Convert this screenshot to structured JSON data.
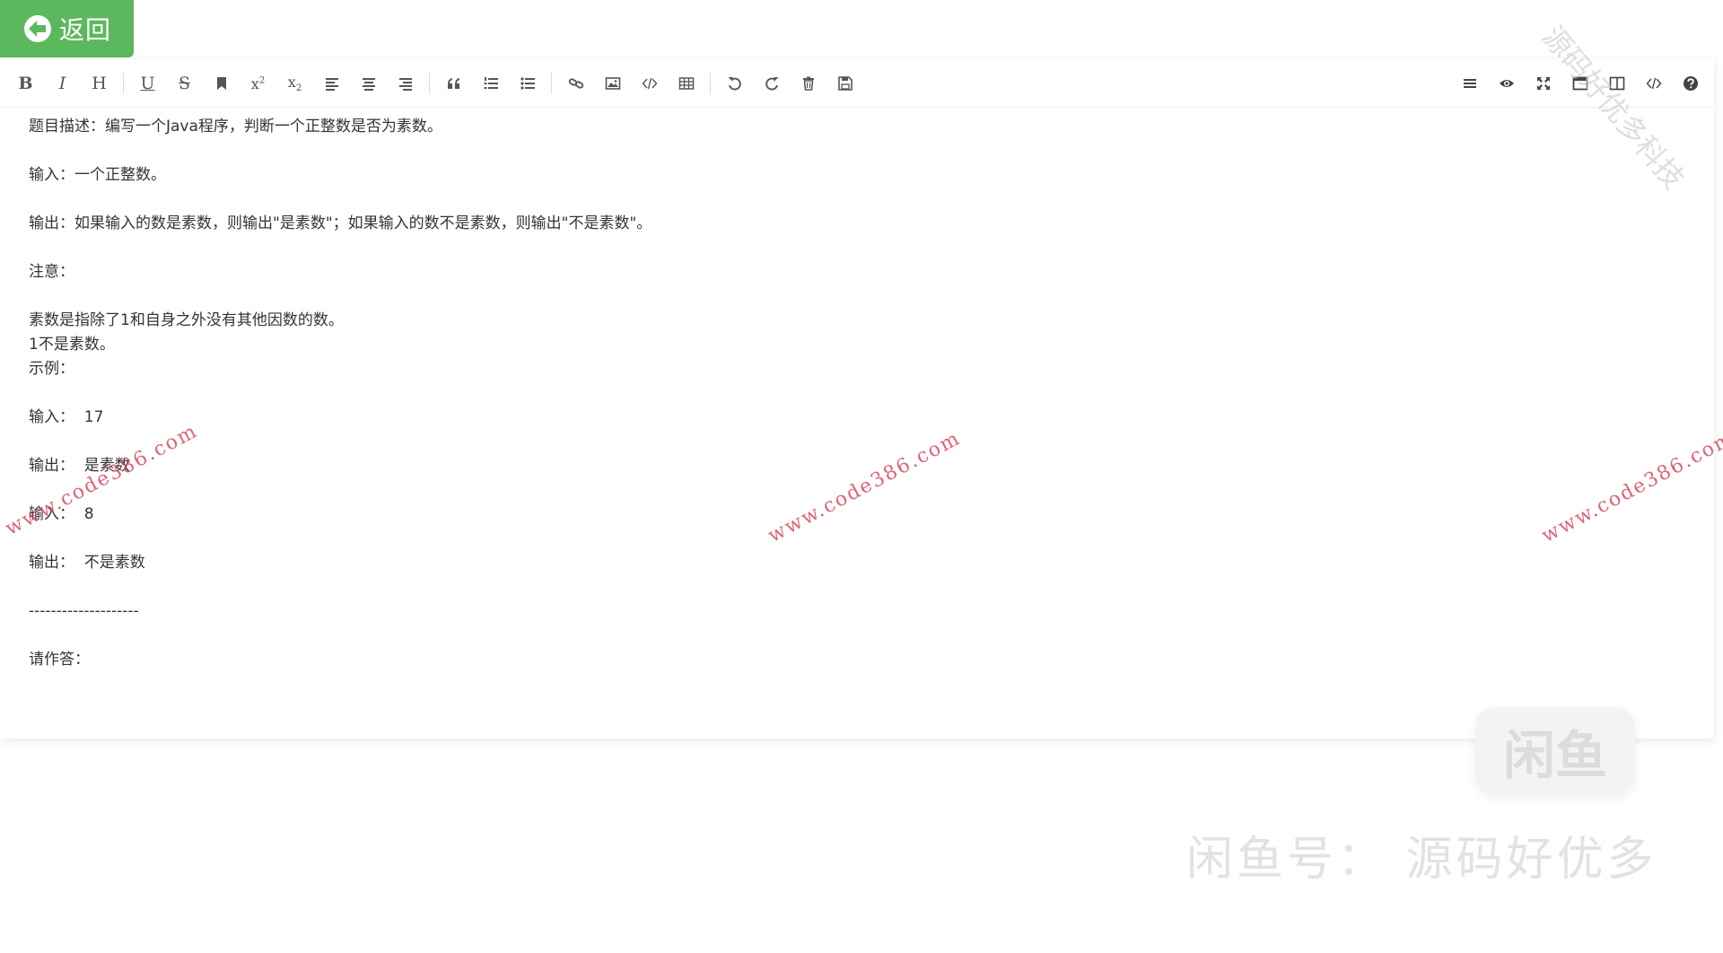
{
  "back_button": {
    "label": "返回",
    "icon": "arrow-left-circle-icon"
  },
  "toolbar": {
    "left": [
      {
        "name": "bold-button",
        "icon": "bold-icon",
        "glyph": "B"
      },
      {
        "name": "italic-button",
        "icon": "italic-icon",
        "glyph": "I"
      },
      {
        "name": "heading-button",
        "icon": "heading-icon",
        "glyph": "H"
      },
      {
        "name": "underline-button",
        "icon": "underline-icon",
        "glyph": "U"
      },
      {
        "name": "strikethrough-button",
        "icon": "strikethrough-icon",
        "glyph": "S"
      },
      {
        "name": "mark-button",
        "icon": "bookmark-icon"
      },
      {
        "name": "superscript-button",
        "icon": "superscript-icon",
        "glyph": "x",
        "small": "2"
      },
      {
        "name": "subscript-button",
        "icon": "subscript-icon",
        "glyph": "x",
        "small": "2"
      },
      {
        "name": "align-left-button",
        "icon": "align-left-icon"
      },
      {
        "name": "align-center-button",
        "icon": "align-center-icon"
      },
      {
        "name": "align-right-button",
        "icon": "align-right-icon"
      },
      {
        "name": "quote-button",
        "icon": "quote-icon"
      },
      {
        "name": "ordered-list-button",
        "icon": "ordered-list-icon"
      },
      {
        "name": "unordered-list-button",
        "icon": "unordered-list-icon"
      },
      {
        "name": "link-button",
        "icon": "link-icon"
      },
      {
        "name": "image-button",
        "icon": "image-icon"
      },
      {
        "name": "code-button",
        "icon": "code-icon"
      },
      {
        "name": "table-button",
        "icon": "table-icon"
      },
      {
        "name": "undo-button",
        "icon": "undo-icon"
      },
      {
        "name": "redo-button",
        "icon": "redo-icon"
      },
      {
        "name": "trash-button",
        "icon": "trash-icon"
      },
      {
        "name": "save-button",
        "icon": "save-icon"
      }
    ],
    "right": [
      {
        "name": "navigation-button",
        "icon": "menu-icon"
      },
      {
        "name": "preview-button",
        "icon": "eye-icon"
      },
      {
        "name": "fullscreen-button",
        "icon": "expand-icon"
      },
      {
        "name": "read-mode-button",
        "icon": "window-icon"
      },
      {
        "name": "split-view-button",
        "icon": "columns-icon"
      },
      {
        "name": "html-code-button",
        "icon": "code-icon"
      },
      {
        "name": "help-button",
        "icon": "question-circle-icon"
      }
    ]
  },
  "content": {
    "lines": [
      "题目描述：编写一个Java程序，判断一个正整数是否为素数。",
      "",
      "输入：一个正整数。",
      "",
      "输出：如果输入的数是素数，则输出\"是素数\"；如果输入的数不是素数，则输出\"不是素数\"。",
      "",
      "注意：",
      "",
      "素数是指除了1和自身之外没有其他因数的数。",
      "1不是素数。",
      "示例：",
      "",
      "输入：  17",
      "",
      "输出：  是素数",
      "",
      "输入：  8",
      "",
      "输出：  不是素数",
      "",
      "--------------------",
      "",
      "请作答："
    ]
  },
  "watermarks": {
    "site": "www.code386.com",
    "corner": "源码好优多科技",
    "xianyu_logo": "闲鱼",
    "xianyu_text": "闲鱼号：  源码好优多"
  },
  "colors": {
    "back_button_bg": "#5cb85c",
    "watermark": "#d9485f",
    "text": "#333333"
  }
}
